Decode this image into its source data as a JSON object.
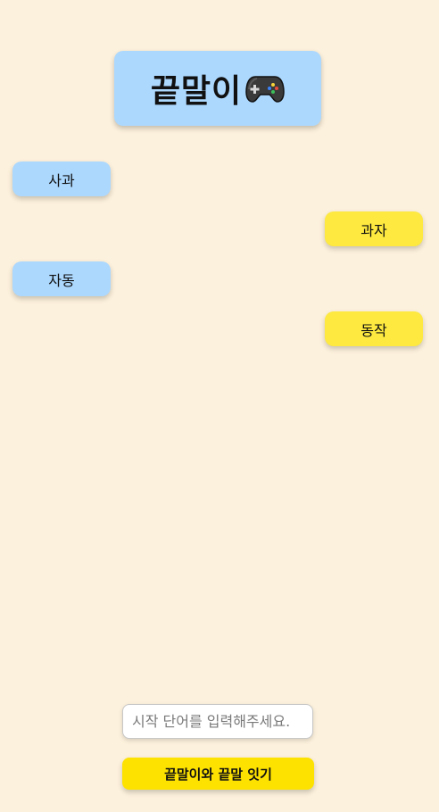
{
  "header": {
    "title": "끝말이",
    "icon": "gamepad-icon"
  },
  "chat": {
    "messages": [
      {
        "text": "사과",
        "side": "left"
      },
      {
        "text": "과자",
        "side": "right"
      },
      {
        "text": "자동",
        "side": "left"
      },
      {
        "text": "동작",
        "side": "right"
      }
    ]
  },
  "input": {
    "placeholder": "시작 단어를 입력해주세요.",
    "value": ""
  },
  "submit": {
    "label": "끝말이와 끝말 잇기"
  },
  "colors": {
    "background": "#fcf1dc",
    "user_bubble": "#acd8fe",
    "bot_bubble": "#fde93f",
    "button": "#fde200"
  }
}
